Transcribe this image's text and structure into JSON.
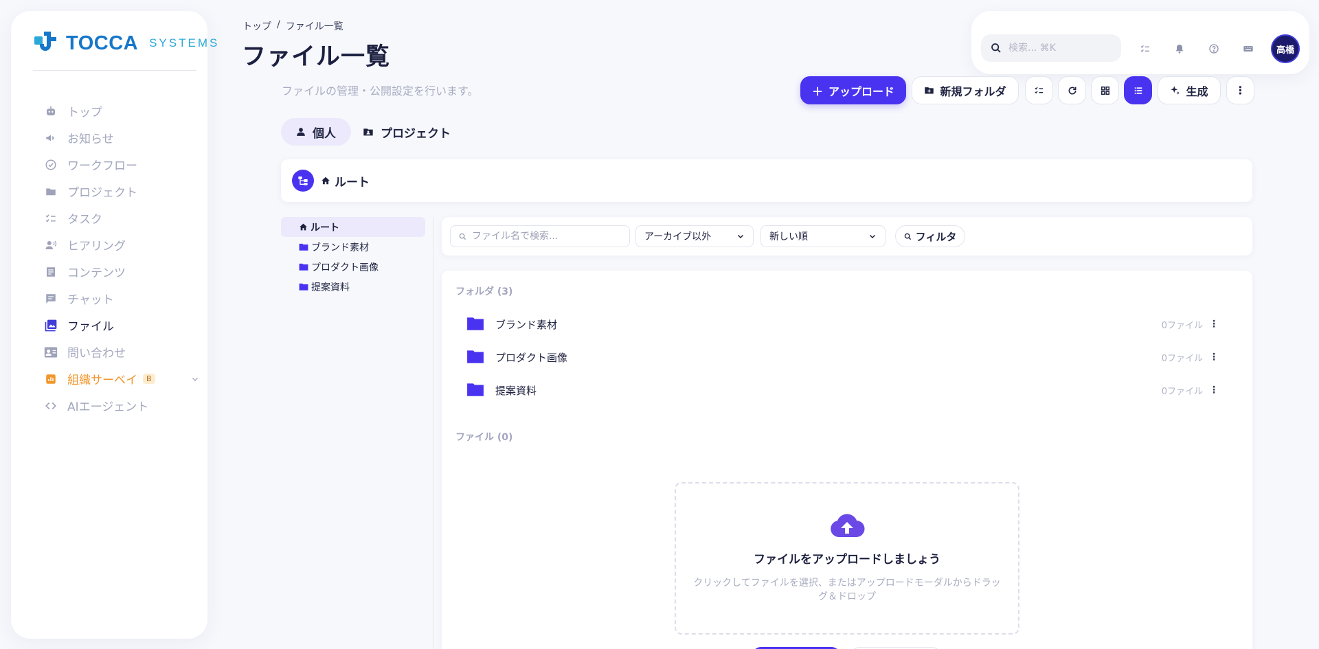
{
  "brand": {
    "name": "TOCCA",
    "sub": "SYSTEMS",
    "accent": "#4a33f0",
    "logo_color": "#1677c9"
  },
  "sidebar": {
    "items": [
      {
        "label": "トップ",
        "icon": "robot-icon",
        "state": "default"
      },
      {
        "label": "お知らせ",
        "icon": "megaphone-icon",
        "state": "default"
      },
      {
        "label": "ワークフロー",
        "icon": "check-circle-icon",
        "state": "default"
      },
      {
        "label": "プロジェクト",
        "icon": "folder-icon",
        "state": "default"
      },
      {
        "label": "タスク",
        "icon": "checklist-icon",
        "state": "default"
      },
      {
        "label": "ヒアリング",
        "icon": "voice-icon",
        "state": "default"
      },
      {
        "label": "コンテンツ",
        "icon": "document-icon",
        "state": "default"
      },
      {
        "label": "チャット",
        "icon": "chat-icon",
        "state": "default"
      },
      {
        "label": "ファイル",
        "icon": "images-icon",
        "state": "active"
      },
      {
        "label": "問い合わせ",
        "icon": "contact-card-icon",
        "state": "default"
      },
      {
        "label": "組織サーベイ",
        "icon": "bar-chart-icon",
        "state": "orange",
        "badge": "B"
      },
      {
        "label": "AIエージェント",
        "icon": "code-icon",
        "state": "default"
      }
    ]
  },
  "header": {
    "breadcrumb": {
      "home": "トップ",
      "sep": "/",
      "current": "ファイル一覧"
    },
    "title": "ファイル一覧",
    "subtitle": "ファイルの管理・公開設定を行います。"
  },
  "topbar": {
    "search_placeholder": "検索... ⌘K",
    "avatar_initials": "高橋"
  },
  "toolbar": {
    "upload_label": "アップロード",
    "new_folder_label": "新規フォルダ",
    "generate_label": "生成"
  },
  "tabs": {
    "personal": "個人",
    "project": "プロジェクト"
  },
  "rootbar": {
    "label": "ルート"
  },
  "tree": {
    "root": "ルート",
    "children": [
      "ブランド素材",
      "プロダクト画像",
      "提案資料"
    ]
  },
  "filters": {
    "search_placeholder": "ファイル名で検索...",
    "archive_value": "アーカイブ以外",
    "sort_value": "新しい順",
    "filter_label": "フィルタ"
  },
  "content": {
    "folders_heading": "フォルダ (3)",
    "folders": [
      {
        "name": "ブランド素材",
        "count": "0ファイル"
      },
      {
        "name": "プロダクト画像",
        "count": "0ファイル"
      },
      {
        "name": "提案資料",
        "count": "0ファイル"
      }
    ],
    "files_heading": "ファイル (0)",
    "empty_title": "ファイルをアップロードしましょう",
    "empty_text": "クリックしてファイルを選択、またはアップロードモーダルからドラッグ＆ドロップ"
  }
}
